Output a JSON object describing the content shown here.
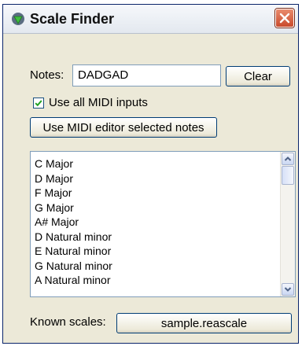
{
  "window": {
    "title": "Scale Finder",
    "icons": {
      "app": "reaper-icon",
      "close": "close-icon"
    }
  },
  "notes": {
    "label": "Notes:",
    "value": "DADGAD",
    "clear_label": "Clear"
  },
  "midi": {
    "use_all_label": "Use all MIDI inputs",
    "use_all_checked": true,
    "editor_selected_label": "Use MIDI editor selected notes"
  },
  "scales": {
    "items": [
      "C Major",
      "D Major",
      "F Major",
      "G Major",
      "A# Major",
      "D Natural minor",
      "E Natural minor",
      "G Natural minor",
      "A Natural minor"
    ]
  },
  "known_scales": {
    "label": "Known scales:",
    "file": "sample.reascale"
  },
  "colors": {
    "accent": "#0a246a",
    "close": "#d9603b"
  }
}
